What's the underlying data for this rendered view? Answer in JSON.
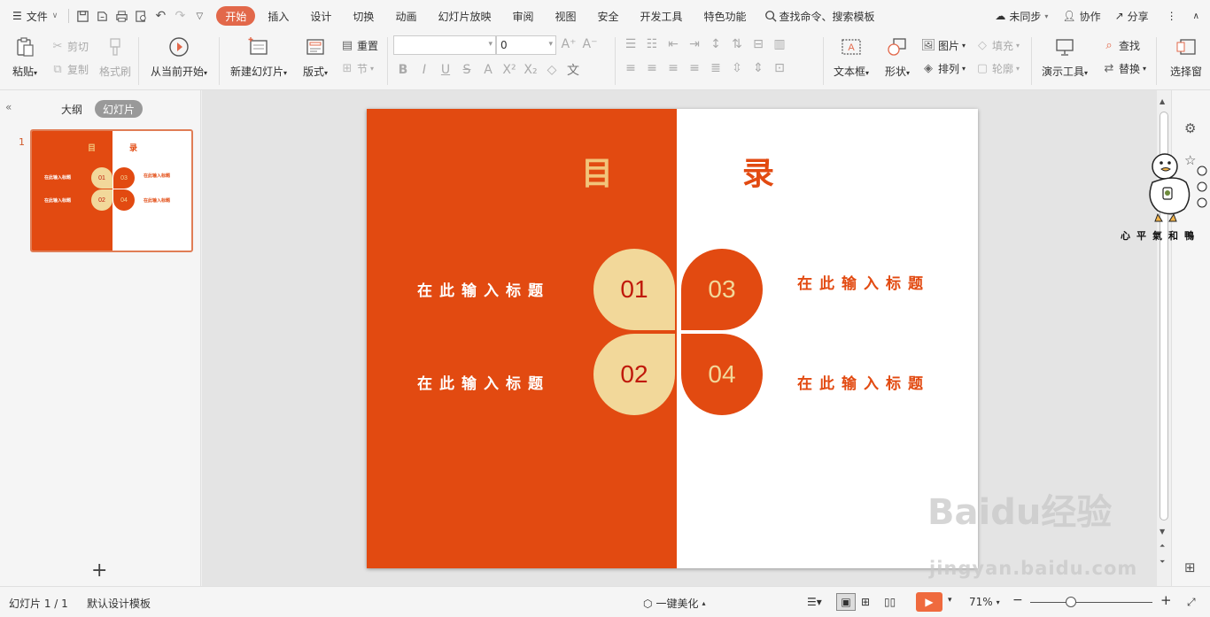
{
  "menubar": {
    "file_label": "文件",
    "tabs": [
      {
        "label": "开始",
        "active": true
      },
      {
        "label": "插入"
      },
      {
        "label": "设计"
      },
      {
        "label": "切换"
      },
      {
        "label": "动画"
      },
      {
        "label": "幻灯片放映"
      },
      {
        "label": "审阅"
      },
      {
        "label": "视图"
      },
      {
        "label": "安全"
      },
      {
        "label": "开发工具"
      },
      {
        "label": "特色功能"
      }
    ],
    "search_label": "查找命令、搜索模板",
    "sync_label": "未同步",
    "collab_label": "协作",
    "share_label": "分享",
    "accent_color": "#e2684a"
  },
  "ribbon": {
    "paste": "粘贴",
    "cut": "剪切",
    "copy": "复制",
    "format_painter": "格式刷",
    "from_current": "从当前开始",
    "new_slide": "新建幻灯片",
    "layout": "版式",
    "reset": "重置",
    "section": "节",
    "font_name": "",
    "font_size": "0",
    "textbox": "文本框",
    "shape": "形状",
    "picture": "图片",
    "fill": "填充",
    "arrange": "排列",
    "outline": "轮廓",
    "presenter_tools": "演示工具",
    "find": "查找",
    "replace": "替换",
    "select_pane": "选择窗"
  },
  "leftpanel": {
    "tab_outline": "大纲",
    "tab_slides": "幻灯片",
    "slide_number": "1"
  },
  "slide": {
    "title_left": "目",
    "title_right": "录",
    "items": [
      {
        "num": "01",
        "label": "在此输入标题"
      },
      {
        "num": "02",
        "label": "在此输入标题"
      },
      {
        "num": "03",
        "label": "在此输入标题"
      },
      {
        "num": "04",
        "label": "在此输入标题"
      }
    ],
    "colors": {
      "orange": "#e24a11",
      "beige": "#f2d89a",
      "num_dark": "#c0190b",
      "title_gold": "#f2c47a"
    }
  },
  "overlays": {
    "duck_caption": "心平氣和鴨",
    "watermark_brand": "Baidu经验",
    "watermark_url": "jingyan.baidu.com"
  },
  "statusbar": {
    "slide_counter": "幻灯片 1 / 1",
    "template": "默认设计模板",
    "beautify": "一键美化",
    "zoom": "71%"
  }
}
